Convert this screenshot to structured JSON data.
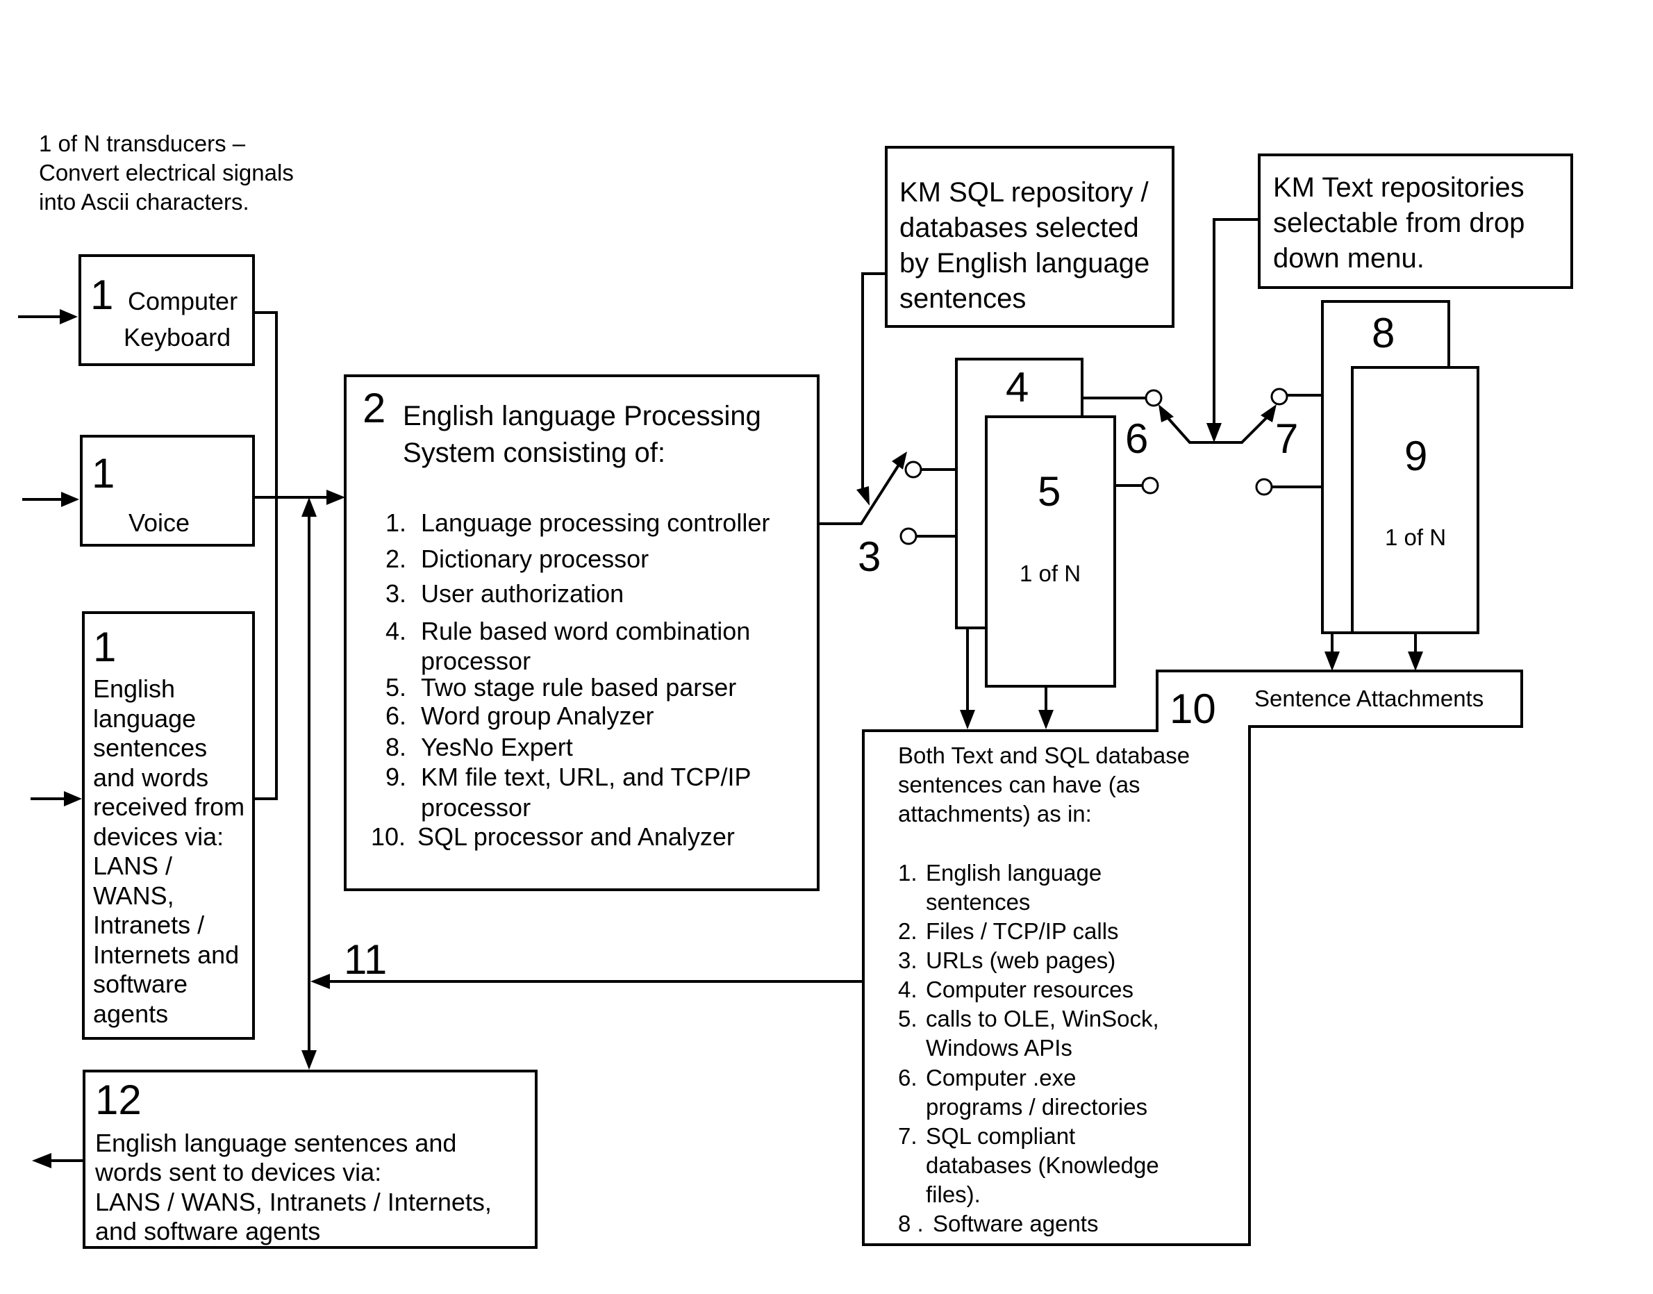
{
  "diagram": {
    "header_note": [
      "1 of N transducers –",
      "Convert electrical signals",
      "into Ascii characters."
    ],
    "box_keyboard": {
      "number": "1",
      "label_lines": [
        "Computer",
        "Keyboard"
      ]
    },
    "box_voice": {
      "number": "1",
      "label": "Voice"
    },
    "box_english_in": {
      "number": "1",
      "label_lines": [
        "English",
        "language",
        "sentences",
        "and words",
        "received from",
        "devices via:",
        "LANS /",
        "WANS,",
        "Intranets /",
        "Internets and",
        "software",
        "agents"
      ]
    },
    "box_processing": {
      "number": "2",
      "title_lines": [
        "English language Processing",
        "System consisting of:"
      ],
      "items": [
        {
          "num": "1.",
          "lines": [
            "Language processing controller"
          ]
        },
        {
          "num": "2.",
          "lines": [
            "Dictionary processor"
          ]
        },
        {
          "num": "3.",
          "lines": [
            "User authorization"
          ]
        },
        {
          "num": "4.",
          "lines": [
            "Rule based word combination",
            "processor"
          ]
        },
        {
          "num": "5.",
          "lines": [
            "Two stage rule based parser"
          ]
        },
        {
          "num": "6.",
          "lines": [
            "Word group Analyzer"
          ]
        },
        {
          "num": "8.",
          "lines": [
            "YesNo Expert"
          ]
        },
        {
          "num": "9.",
          "lines": [
            "KM file text,  URL, and TCP/IP",
            "processor"
          ]
        },
        {
          "num": "10.",
          "lines": [
            "SQL processor and Analyzer"
          ]
        }
      ]
    },
    "switch_3_label": "3",
    "box_sql_repo": {
      "label_lines": [
        "KM SQL repository /",
        "databases  selected",
        "by English language",
        "sentences"
      ]
    },
    "box_text_repo": {
      "label_lines": [
        "KM Text repositories",
        "selectable from drop",
        "down menu."
      ]
    },
    "box_4": {
      "number": "4"
    },
    "box_5": {
      "number": "5",
      "sub": "1 of N"
    },
    "switch_6_label": "6",
    "switch_7_label": "7",
    "box_8": {
      "number": "8"
    },
    "box_9": {
      "number": "9",
      "sub": "1 of N"
    },
    "box_10": {
      "number": "10",
      "tab_label": "Sentence Attachments",
      "intro_lines": [
        "Both Text and SQL database",
        "sentences can have (as",
        "attachments) as in:"
      ],
      "items": [
        {
          "num": "1.",
          "lines": [
            "English language",
            "sentences"
          ]
        },
        {
          "num": "2.",
          "lines": [
            "Files / TCP/IP calls"
          ]
        },
        {
          "num": "3.",
          "lines": [
            "URLs (web pages)"
          ]
        },
        {
          "num": "4.",
          "lines": [
            "Computer resources"
          ]
        },
        {
          "num": "5.",
          "lines": [
            "calls to OLE, WinSock,",
            "Windows APIs"
          ]
        },
        {
          "num": "6.",
          "lines": [
            "Computer .exe",
            "programs / directories"
          ]
        },
        {
          "num": "7.",
          "lines": [
            "SQL compliant",
            "databases (Knowledge",
            "files)."
          ]
        },
        {
          "num": "8 .",
          "lines": [
            "Software agents"
          ]
        }
      ]
    },
    "arrow_11_label": "11",
    "box_12": {
      "number": "12",
      "label_lines": [
        "English language sentences and",
        "words sent to devices via:",
        "LANS / WANS, Intranets / Internets,",
        "and software agents"
      ]
    }
  }
}
